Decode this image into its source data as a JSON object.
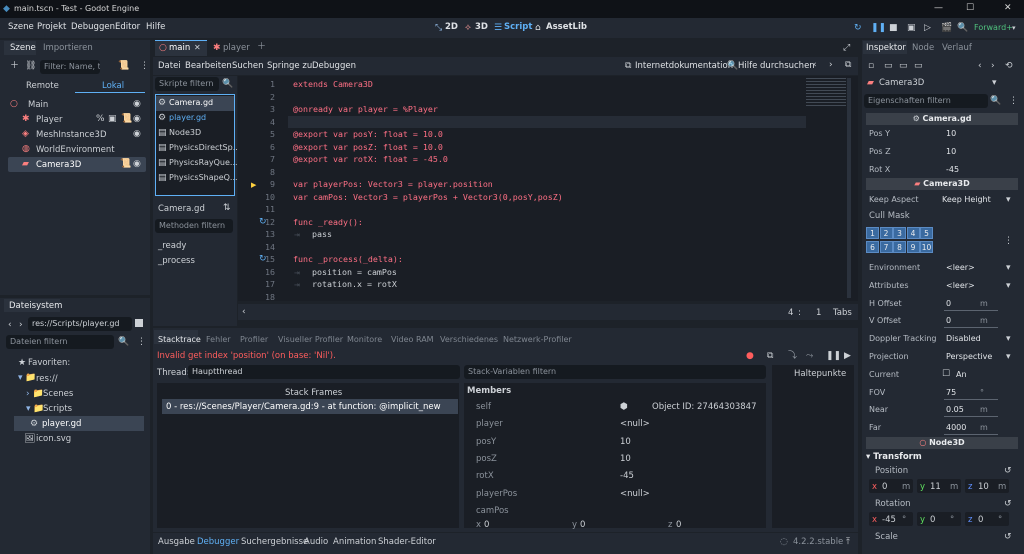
{
  "window": {
    "title": "main.tscn - Test - Godot Engine"
  },
  "menu": [
    "Szene",
    "Projekt",
    "Debuggen",
    "Editor",
    "Hilfe"
  ],
  "workspaces": [
    "2D",
    "3D",
    "Script",
    "AssetLib"
  ],
  "renderer": "Forward+",
  "scene_dock": {
    "tabs": [
      "Szene",
      "Importieren"
    ],
    "filter_placeholder": "Filter: Name, t:T",
    "remote": "Remote",
    "local": "Lokal",
    "nodes": [
      "Main",
      "Player",
      "MeshInstance3D",
      "WorldEnvironment",
      "Camera3D"
    ]
  },
  "filesystem": {
    "tab": "Dateisystem",
    "path": "res://Scripts/player.gd",
    "filter_placeholder": "Dateien filtern",
    "items": [
      "Favoriten:",
      "res://",
      "Scenes",
      "Scripts",
      "player.gd",
      "icon.svg"
    ]
  },
  "editor_tabs": [
    "main",
    "player"
  ],
  "script_menu": [
    "Datei",
    "Bearbeiten",
    "Suchen",
    "Springe zu",
    "Debuggen"
  ],
  "script_tools": {
    "docs": "Internetdokumentation",
    "help": "Hilfe durchsuchen"
  },
  "scripts_filter": "Skripte filtern",
  "script_list": [
    "Camera.gd",
    "player.gd",
    "Node3D",
    "PhysicsDirectSp...",
    "PhysicsRayQue...",
    "PhysicsShapeQ..."
  ],
  "current_script": "Camera.gd",
  "methods_filter": "Methoden filtern",
  "methods": [
    "_ready",
    "_process"
  ],
  "code": [
    {
      "n": "1",
      "t": "extends Camera3D"
    },
    {
      "n": "2",
      "t": ""
    },
    {
      "n": "3",
      "t": "@onready var player = %Player"
    },
    {
      "n": "4",
      "t": ""
    },
    {
      "n": "5",
      "t": "@export var posY: float = 10.0"
    },
    {
      "n": "6",
      "t": "@export var posZ: float = 10.0"
    },
    {
      "n": "7",
      "t": "@export var rotX: float = -45.0"
    },
    {
      "n": "8",
      "t": ""
    },
    {
      "n": "9",
      "t": "var playerPos: Vector3 = player.position"
    },
    {
      "n": "10",
      "t": "var camPos: Vector3 = playerPos + Vector3(0,posY,posZ)"
    },
    {
      "n": "11",
      "t": ""
    },
    {
      "n": "12",
      "t": "func _ready():"
    },
    {
      "n": "13",
      "t": "pass"
    },
    {
      "n": "14",
      "t": ""
    },
    {
      "n": "15",
      "t": "func _process(_delta):"
    },
    {
      "n": "16",
      "t": "position = camPos"
    },
    {
      "n": "17",
      "t": "rotation.x = rotX"
    },
    {
      "n": "18",
      "t": ""
    }
  ],
  "status": {
    "line": "4",
    "col": "1",
    "indent": "Tabs"
  },
  "bottom_tabs": [
    "Stacktrace",
    "Fehler",
    "Profiler",
    "Visueller Profiler",
    "Monitore",
    "Video RAM",
    "Verschiedenes",
    "Netzwerk-Profiler"
  ],
  "error_msg": "Invalid get index 'position' (on base: 'Nil').",
  "thread_label": "Thread:",
  "thread_value": "Hauptthread",
  "stack_header": "Stack Frames",
  "stack_frame": "0 - res://Scenes/Player/Camera.gd:9 - at function: @implicit_new",
  "stackvar_filter": "Stack-Variablen filtern",
  "members_label": "Members",
  "vars": [
    {
      "name": "self",
      "value": "Object ID: 27464303847"
    },
    {
      "name": "player",
      "value": "<null>"
    },
    {
      "name": "posY",
      "value": "10"
    },
    {
      "name": "posZ",
      "value": "10"
    },
    {
      "name": "rotX",
      "value": "-45"
    },
    {
      "name": "playerPos",
      "value": "<null>"
    },
    {
      "name": "camPos",
      "value": ""
    }
  ],
  "campos_xyz": [
    "x",
    "0",
    "y",
    "0",
    "z",
    "0"
  ],
  "breakpoints": "Haltepunkte",
  "footer_tabs": [
    "Ausgabe",
    "Debugger",
    "Suchergebnisse",
    "Audio",
    "Animation",
    "Shader-Editor"
  ],
  "version": "4.2.2.stable",
  "inspector": {
    "tabs": [
      "Inspektor",
      "Node",
      "Verlauf"
    ],
    "object": "Camera3D",
    "filter": "Eigenschaften filtern",
    "script_section": "Camera.gd",
    "script_props": [
      {
        "l": "Pos Y",
        "v": "10"
      },
      {
        "l": "Pos Z",
        "v": "10"
      },
      {
        "l": "Rot X",
        "v": "-45"
      }
    ],
    "cam_section": "Camera3D",
    "keep_aspect": {
      "l": "Keep Aspect",
      "v": "Keep Height"
    },
    "cull_mask": "Cull Mask",
    "layers": [
      "1",
      "2",
      "3",
      "4",
      "5",
      "6",
      "7",
      "8",
      "9",
      "10"
    ],
    "props": [
      {
        "l": "Environment",
        "v": "<leer>"
      },
      {
        "l": "Attributes",
        "v": "<leer>"
      },
      {
        "l": "H Offset",
        "v": "0",
        "u": "m"
      },
      {
        "l": "V Offset",
        "v": "0",
        "u": "m"
      },
      {
        "l": "Doppler Tracking",
        "v": "Disabled"
      },
      {
        "l": "Projection",
        "v": "Perspective"
      },
      {
        "l": "Current",
        "v": "An"
      },
      {
        "l": "FOV",
        "v": "75",
        "u": "°"
      },
      {
        "l": "Near",
        "v": "0.05",
        "u": "m"
      },
      {
        "l": "Far",
        "v": "4000",
        "u": "m"
      }
    ],
    "node3d_section": "Node3D",
    "transform": "Transform",
    "position_lbl": "Position",
    "pos": [
      "x",
      "0",
      "m",
      "y",
      "11",
      "m",
      "z",
      "10",
      "m"
    ],
    "rotation_lbl": "Rotation",
    "rot": [
      "x",
      "-45",
      "°",
      "y",
      "0",
      "°",
      "z",
      "0",
      "°"
    ],
    "scale_lbl": "Scale"
  },
  "colors": {
    "accent": "#5fb0f5",
    "error": "#ff5d5d",
    "keyword": "#ff7085",
    "type": "#42ffc2"
  }
}
